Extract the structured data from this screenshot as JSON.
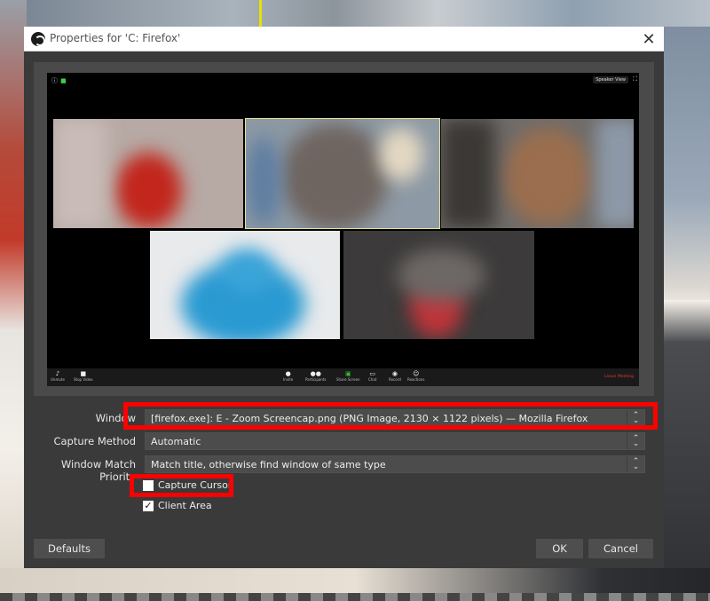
{
  "dialog": {
    "title": "Properties for 'C: Firefox'",
    "close_glyph": "✕"
  },
  "preview": {
    "speaker_view": "Speaker View",
    "toolbar": {
      "mute": "Unmute",
      "stop_video": "Stop Video",
      "invite": "Invite",
      "participants": "Participants",
      "share_screen": "Share Screen",
      "chat": "Chat",
      "record": "Record",
      "reactions": "Reactions",
      "leave": "Leave Meeting"
    }
  },
  "form": {
    "window_label": "Window",
    "window_value": "[firefox.exe]: E - Zoom Screencap.png (PNG Image, 2130 × 1122 pixels) — Mozilla Firefox",
    "capture_method_label": "Capture Method",
    "capture_method_value": "Automatic",
    "match_priority_label": "Window Match Priority",
    "match_priority_value": "Match title, otherwise find window of same type",
    "capture_cursor_label": "Capture Cursor",
    "client_area_label": "Client Area",
    "client_area_check": "✓"
  },
  "buttons": {
    "defaults": "Defaults",
    "ok": "OK",
    "cancel": "Cancel"
  },
  "colors": {
    "highlight": "#ff0000",
    "dialog_bg": "#3a3a3a"
  },
  "icons": {
    "app": "obs-icon",
    "close": "close-icon",
    "dropdown": "updown-arrows-icon"
  }
}
